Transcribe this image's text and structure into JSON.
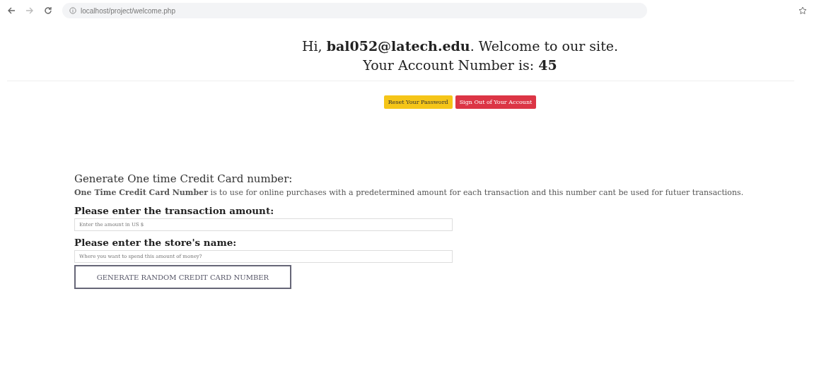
{
  "browser": {
    "url": "localhost/project/welcome.php"
  },
  "greeting": {
    "line_1": "Hi, **bal052@latech.edu**. Welcome to our site.",
    "line_2": "Your Account Number is: **45**"
  },
  "buttons": [
    {
      "label": "Reset Your Password",
      "kind": "warning"
    },
    {
      "label": "Sign Out of Your Account",
      "kind": "danger"
    }
  ],
  "section": {
    "title": "Generate One time Credit Card number:",
    "description": "**One Time Credit Card Number** is to use for online purchases with a predetermined amount for each transaction and this number cant be used for futuer transactions.",
    "fields": [
      {
        "label": "Please enter the transaction amount:",
        "placeholder": "Enter the amount in US $"
      },
      {
        "label": "Please enter the store's name:",
        "placeholder": "Where you want to spend this amount of money?"
      }
    ],
    "submit": "GENERATE RANDOM CREDIT CARD NUMBER"
  }
}
